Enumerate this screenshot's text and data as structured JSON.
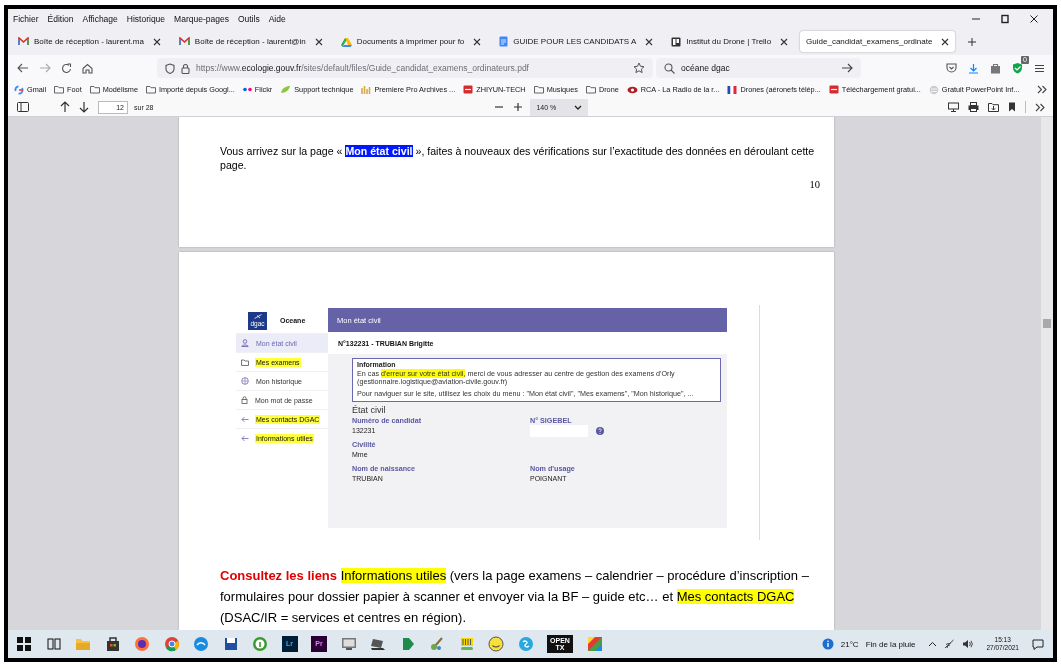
{
  "menu_bar": [
    "Fichier",
    "Édition",
    "Affichage",
    "Historique",
    "Marque-pages",
    "Outils",
    "Aide"
  ],
  "tabs": [
    {
      "label": "Boîte de réception - laurent.ma",
      "selected": false
    },
    {
      "label": "Boîte de réception - laurent@in",
      "selected": false
    },
    {
      "label": "Documents à imprimer pour fo",
      "selected": false
    },
    {
      "label": "GUIDE POUR LES CANDIDATS A",
      "selected": false
    },
    {
      "label": "Institut du Drone | Trello",
      "selected": false
    },
    {
      "label": "Guide_candidat_examens_ordinate",
      "selected": true
    }
  ],
  "address_bar": {
    "scheme": "https://www.",
    "domain": "ecologie.gouv.fr",
    "path": "/sites/default/files/Guide_candidat_examens_ordinateurs.pdf"
  },
  "search_field": {
    "value": "océane dgac"
  },
  "extension_badge": "0",
  "bookmarks": [
    "Gmail",
    "Foot",
    "Modélisme",
    "Importé depuis Googl...",
    "Flickr",
    "Support technique",
    "Premiere Pro Archives ...",
    "ZHIYUN-TECH",
    "Musiques",
    "Drone",
    "RCA - La Radio de la r...",
    "Drones (aéronefs télép...",
    "Téléchargement gratui...",
    "Gratuit PowerPoint Inf..."
  ],
  "pdf_toolbar": {
    "page": "12",
    "page_count": "sur 28",
    "zoom": "140 %"
  },
  "document": {
    "page_1": {
      "paragraph": [
        {
          "text": "Vous arrivez sur la page « ",
          "kind": "plain"
        },
        {
          "text": "Mon état civil",
          "kind": "selected"
        },
        {
          "text": " », faites à nouveaux des vérifications sur l’exactitude des données en déroulant cette page.",
          "kind": "plain"
        }
      ],
      "page_number": "10"
    },
    "page_2": {
      "screenshot": {
        "logo_text": "dgac",
        "app_name": "Oceane",
        "header_title": "Mon état civil",
        "menu": [
          {
            "label": "Mon état civil",
            "selected": true,
            "highlighted": false
          },
          {
            "label": "Mes examens",
            "selected": false,
            "highlighted": true
          },
          {
            "label": "Mon historique",
            "selected": false,
            "highlighted": false
          },
          {
            "label": "Mon mot de passe",
            "selected": false,
            "highlighted": false
          },
          {
            "label": "Mes contacts DGAC",
            "selected": false,
            "highlighted": true
          },
          {
            "label": "Informations utiles",
            "selected": false,
            "highlighted": true
          }
        ],
        "candidate": "N°132231 - TRUBIAN Brigitte",
        "info_box": {
          "title": "Information",
          "paragraph": [
            {
              "text": "En cas ",
              "kind": "plain"
            },
            {
              "text": "d'erreur sur votre état civil,",
              "kind": "highlight"
            },
            {
              "text": " merci de vous adresser au centre de gestion des examens d'Orly (gestionnaire.logistique@aviation-civile.gouv.fr)",
              "kind": "plain"
            }
          ],
          "note": "Pour naviguer sur le site, utilisez les choix du menu : \"Mon état civil\", \"Mes examens\", \"Mon historique\", ..."
        },
        "section_title": "État civil",
        "fields": [
          {
            "label": "Numéro de candidat",
            "value": "132231",
            "kind": "text"
          },
          {
            "label": "N° SIGEBEL",
            "kind": "input"
          },
          {
            "label": "Civilité",
            "value": "Mme",
            "kind": "text"
          },
          {
            "kind": "empty"
          },
          {
            "label": "Nom de naissance",
            "value": "TRUBIAN",
            "kind": "text"
          },
          {
            "label": "Nom d'usage",
            "value": "POIGNANT",
            "kind": "text"
          }
        ]
      },
      "paragraph": [
        {
          "text": "Consultez les liens ",
          "kind": "red_bold"
        },
        {
          "text": "Informations utiles",
          "kind": "highlight"
        },
        {
          "text": " (vers la page examens – calendrier – procédure d’inscription – formulaires pour dossier papier à scanner et envoyer via la BF – guide etc…   et ",
          "kind": "plain"
        },
        {
          "text": "Mes contacts DGAC",
          "kind": "highlight"
        },
        {
          "text": " (DSAC/IR = services et centres en région).",
          "kind": "plain"
        }
      ]
    }
  },
  "taskbar": {
    "app_badges": [
      "Lr",
      "Pr",
      "OPEN TX"
    ],
    "temperature": "21°C",
    "weather": "Fin de la pluie",
    "time": "15:13",
    "date": "27/07/2021"
  }
}
